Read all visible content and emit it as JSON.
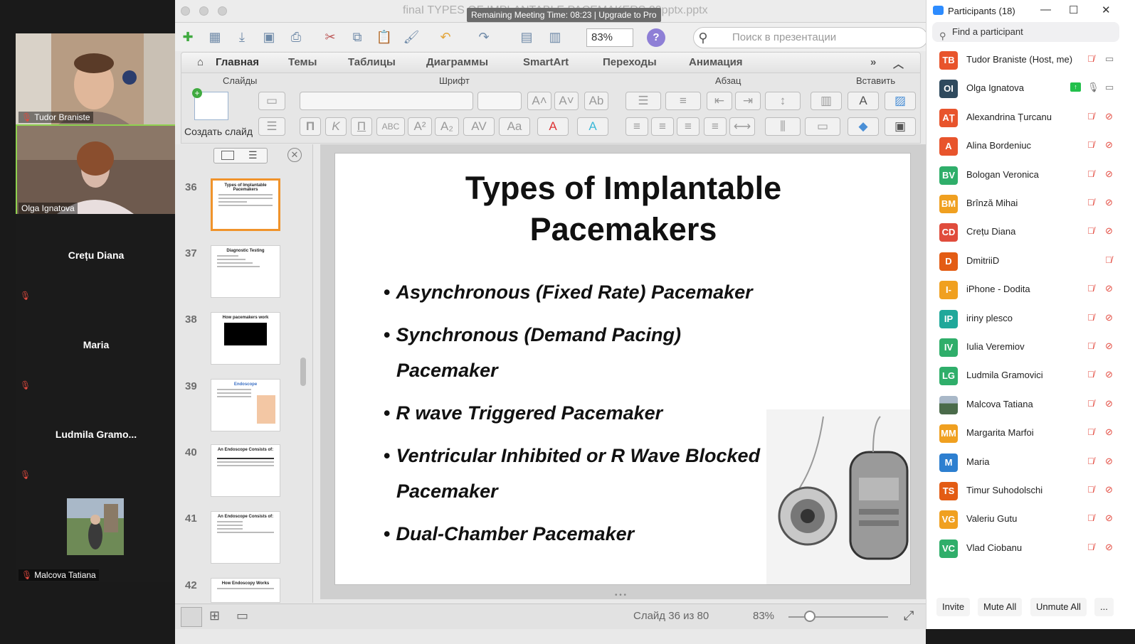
{
  "video_tiles": [
    {
      "name": "Tudor Braniste",
      "has_video": true
    },
    {
      "name": "Olga Ignatova",
      "has_video": true,
      "active": true
    },
    {
      "name": "Crețu Diana",
      "has_video": false
    },
    {
      "name": "Maria",
      "has_video": false
    },
    {
      "name": "Ludmila Gramo...",
      "has_video": false
    },
    {
      "name": "Malcova Tatiana",
      "has_video": true
    }
  ],
  "ppt": {
    "doc_title": "finaI TYPES OF IMPLANTABLE PACEMAKERS 20pptx.pptx",
    "meeting_banner": "Remaining Meeting Time: 08:23 | Upgrade to Pro",
    "zoom": "83%",
    "search_placeholder": "Поиск в презентации",
    "tabs": [
      "Главная",
      "Темы",
      "Таблицы",
      "Диаграммы",
      "SmartArt",
      "Переходы",
      "Анимация"
    ],
    "groups": {
      "slides": "Слайды",
      "font": "Шрифт",
      "paragraph": "Абзац",
      "insert": "Вставить"
    },
    "create_slide": "Создать слайд",
    "thumbnails": [
      {
        "num": "36",
        "title": "Types of Implantable Pacemakers",
        "selected": true
      },
      {
        "num": "37",
        "title": "Diagnostic Testing"
      },
      {
        "num": "38",
        "title": "How pacemakers work"
      },
      {
        "num": "39",
        "title": "Endoscope"
      },
      {
        "num": "40",
        "title": "An Endoscope Consists of:"
      },
      {
        "num": "41",
        "title": "An Endoscope Consists of:"
      },
      {
        "num": "42",
        "title": "How Endoscopy Works"
      }
    ],
    "slide": {
      "title_line1": "Types of Implantable",
      "title_line2": "Pacemakers",
      "bullets": [
        "Asynchronous (Fixed Rate) Pacemaker",
        "Synchronous (Demand Pacing) Pacemaker",
        "R wave Triggered Pacemaker",
        "Ventricular Inhibited or R Wave Blocked Pacemaker",
        "Dual-Chamber Pacemaker"
      ]
    },
    "status": {
      "slide_counter": "Слайд 36 из 80",
      "zoom": "83%"
    }
  },
  "participants": {
    "title": "Participants (18)",
    "search_placeholder": "Find a participant",
    "list": [
      {
        "initials": "TB",
        "name": "Tudor Braniste (Host, me)",
        "color": "#e8542c",
        "mic_muted": true,
        "cam_off": false
      },
      {
        "initials": "OI",
        "name": "Olga Ignatova",
        "color": "#2f4a5e",
        "mic_muted": false,
        "cam_off": false,
        "sharing": true
      },
      {
        "initials": "AȚ",
        "name": "Alexandrina Țurcanu",
        "color": "#e8542c",
        "mic_muted": true,
        "cam_off": true
      },
      {
        "initials": "A",
        "name": "Alina Bordeniuc",
        "color": "#e8542c",
        "mic_muted": true,
        "cam_off": true
      },
      {
        "initials": "BV",
        "name": "Bologan Veronica",
        "color": "#2fae6a",
        "mic_muted": true,
        "cam_off": true
      },
      {
        "initials": "BM",
        "name": "Brînză Mihai",
        "color": "#f0a020",
        "mic_muted": true,
        "cam_off": true
      },
      {
        "initials": "CD",
        "name": "Crețu Diana",
        "color": "#e04c3c",
        "mic_muted": true,
        "cam_off": true
      },
      {
        "initials": "D",
        "name": "DmitriiD",
        "color": "#e35c14",
        "mic_muted": true,
        "cam_off": null
      },
      {
        "initials": "I-",
        "name": "iPhone - Dodita",
        "color": "#f0a020",
        "mic_muted": true,
        "cam_off": true
      },
      {
        "initials": "IP",
        "name": "iriny plesco",
        "color": "#1fa89a",
        "mic_muted": true,
        "cam_off": true
      },
      {
        "initials": "IV",
        "name": "Iulia Veremiov",
        "color": "#2fae6a",
        "mic_muted": true,
        "cam_off": true
      },
      {
        "initials": "LG",
        "name": "Ludmila Gramovici",
        "color": "#2fae6a",
        "mic_muted": true,
        "cam_off": true
      },
      {
        "initials": "",
        "name": "Malcova Tatiana",
        "color": "#4a6b4a",
        "mic_muted": true,
        "cam_off": true,
        "photo": true
      },
      {
        "initials": "MM",
        "name": "Margarita Marfoi",
        "color": "#f0a020",
        "mic_muted": true,
        "cam_off": true
      },
      {
        "initials": "M",
        "name": "Maria",
        "color": "#2d7fd0",
        "mic_muted": true,
        "cam_off": true
      },
      {
        "initials": "TS",
        "name": "Timur Suhodolschi",
        "color": "#e35c14",
        "mic_muted": true,
        "cam_off": true
      },
      {
        "initials": "VG",
        "name": "Valeriu Gutu",
        "color": "#f0a020",
        "mic_muted": true,
        "cam_off": true
      },
      {
        "initials": "VC",
        "name": "Vlad Ciobanu",
        "color": "#2fae6a",
        "mic_muted": true,
        "cam_off": true
      }
    ],
    "buttons": {
      "invite": "Invite",
      "mute_all": "Mute All",
      "unmute_all": "Unmute All",
      "more": "..."
    }
  }
}
